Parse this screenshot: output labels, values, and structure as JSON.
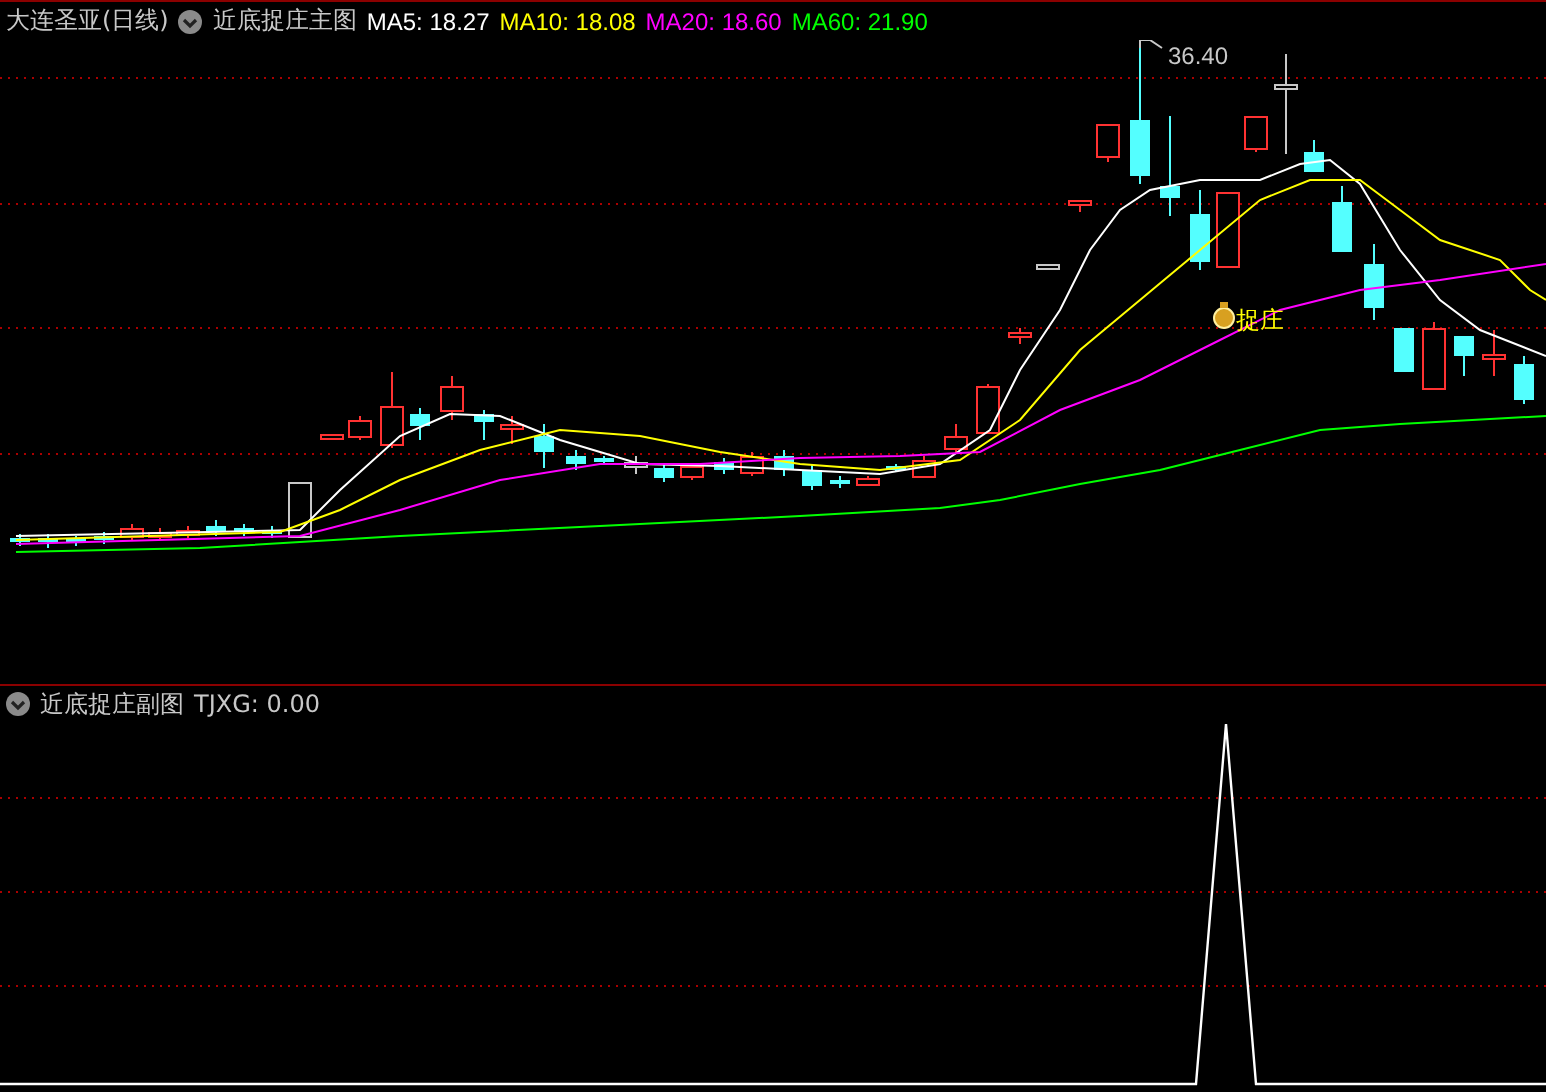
{
  "main_panel": {
    "title": "大连圣亚(日线)",
    "indicator": "近底捉庄主图",
    "moving_averages": [
      {
        "label": "MA5:",
        "value": "18.27",
        "color": "#ffffff"
      },
      {
        "label": "MA10:",
        "value": "18.08",
        "color": "#ffff00"
      },
      {
        "label": "MA20:",
        "value": "18.60",
        "color": "#ff00ff"
      },
      {
        "label": "MA60:",
        "value": "21.90",
        "color": "#00ff00"
      }
    ],
    "high_marker": "36.40",
    "signal_label": "捉庄"
  },
  "sub_panel": {
    "indicator": "近底捉庄副图",
    "reading": "TJXG: 0.00"
  }
}
